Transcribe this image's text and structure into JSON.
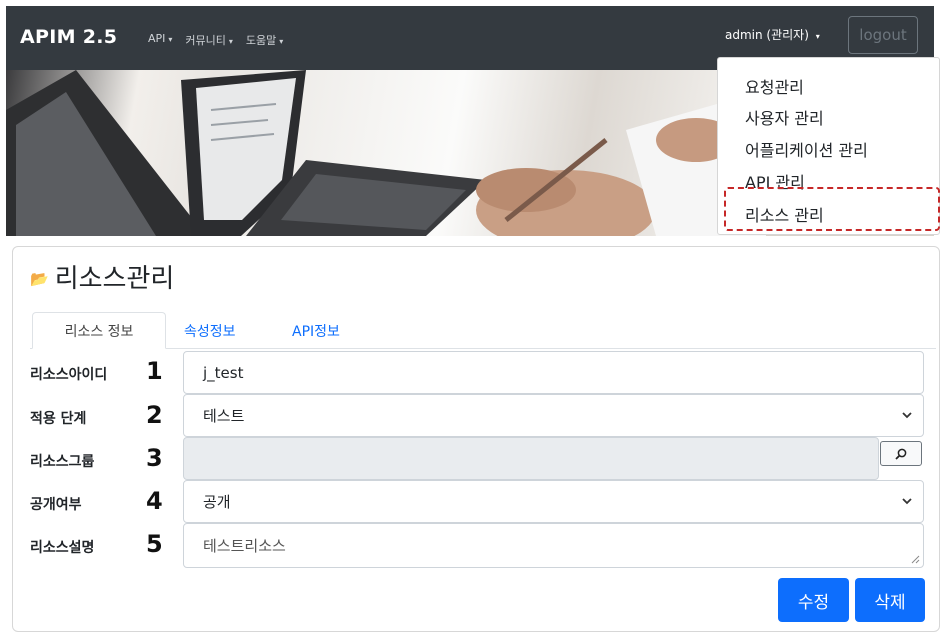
{
  "app": {
    "title": "APIM 2.5"
  },
  "nav": {
    "items": [
      {
        "label": "API"
      },
      {
        "label": "커뮤니티"
      },
      {
        "label": "도움말"
      }
    ]
  },
  "user": {
    "label": "admin (관리자)",
    "logout_label": "logout"
  },
  "dropdown": {
    "items": [
      {
        "label": "요청관리"
      },
      {
        "label": "사용자 관리"
      },
      {
        "label": "어플리케이션 관리"
      },
      {
        "label": "API 관리"
      },
      {
        "label": "리소스 관리"
      }
    ]
  },
  "page": {
    "title": "리소스관리"
  },
  "tabs": [
    {
      "label": "리소스 정보"
    },
    {
      "label": "속성정보"
    },
    {
      "label": "API정보"
    }
  ],
  "form": {
    "fields": [
      {
        "label": "리소스아이디",
        "marker": "1",
        "value": "j_test"
      },
      {
        "label": "적용 단계",
        "marker": "2",
        "value": "테스트"
      },
      {
        "label": "리소스그룹",
        "marker": "3",
        "value": ""
      },
      {
        "label": "공개여부",
        "marker": "4",
        "value": "공개"
      },
      {
        "label": "리소스설명",
        "marker": "5",
        "value": "테스트리소스"
      }
    ]
  },
  "buttons": {
    "edit": "수정",
    "delete": "삭제"
  },
  "colors": {
    "navbar": "#343a40",
    "primary": "#0d6efd",
    "highlight": "#c62828"
  },
  "icons": {
    "page_title": "folder-open-icon",
    "group_search": "search-icon",
    "select": "chevron-down-icon"
  }
}
